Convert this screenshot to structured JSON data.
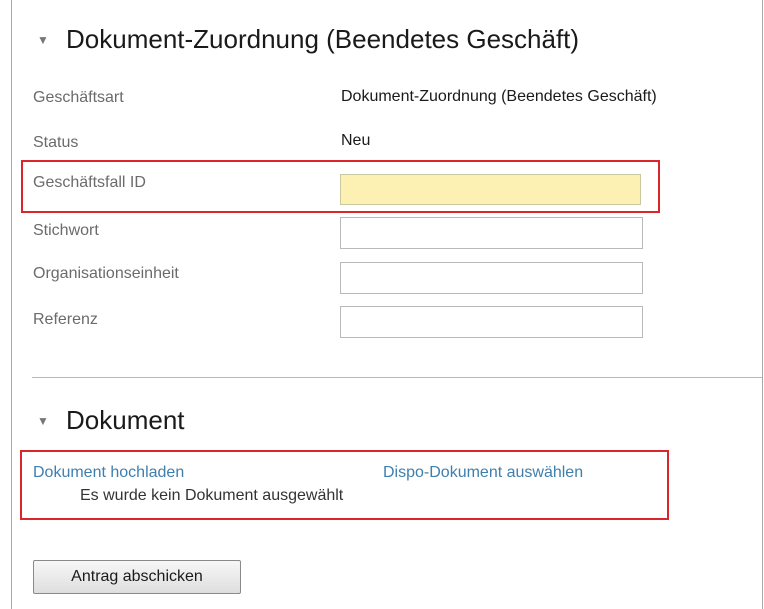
{
  "business_section": {
    "title": "Dokument-Zuordnung (Beendetes Geschäft)",
    "chevron_icon": "chevron-down-icon",
    "fields": {
      "business_type": {
        "label": "Geschäftsart",
        "value": "Dokument-Zuordnung (Beendetes Geschäft)"
      },
      "status": {
        "label": "Status",
        "value": "Neu"
      },
      "case_id": {
        "label": "Geschäftsfall ID",
        "value": "",
        "placeholder": ""
      },
      "keyword": {
        "label": "Stichwort",
        "value": "",
        "placeholder": ""
      },
      "org_unit": {
        "label": "Organisationseinheit",
        "value": "",
        "placeholder": ""
      },
      "reference": {
        "label": "Referenz",
        "value": "",
        "placeholder": ""
      }
    }
  },
  "document_section": {
    "title": "Dokument",
    "chevron_icon": "chevron-down-icon",
    "upload_link": "Dokument hochladen",
    "select_dispo_link": "Dispo-Dokument auswählen",
    "no_document_note": "Es wurde kein Dokument ausgewählt"
  },
  "actions": {
    "submit_label": "Antrag abschicken"
  },
  "colors": {
    "highlight": "#d8262b",
    "required_field": "#fdf0b3",
    "link": "#3f7fae"
  }
}
